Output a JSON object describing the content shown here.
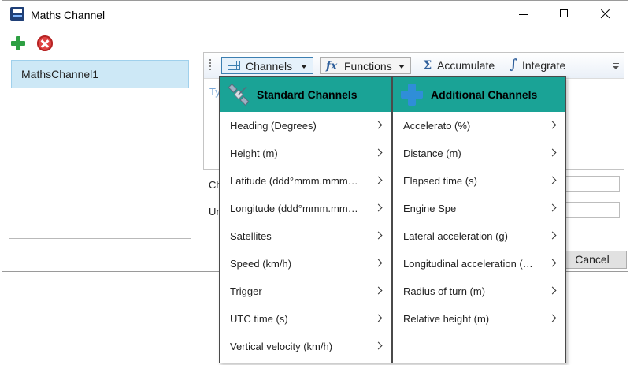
{
  "window": {
    "title": "Maths Channel"
  },
  "channel_list": {
    "items": [
      "MathsChannel1"
    ]
  },
  "toolbar": {
    "channels_label": "Channels",
    "functions_label": "Functions",
    "accumulate_label": "Accumulate",
    "integrate_label": "Integrate"
  },
  "editor": {
    "placeholder_fragment": "Ty"
  },
  "fields": {
    "label1_fragment": "Ch",
    "label2_fragment": "Un"
  },
  "buttons": {
    "cancel_label": "Cancel"
  },
  "menu": {
    "standard_header": "Standard Channels",
    "additional_header": "Additional Channels",
    "standard_items": [
      "Heading (Degrees)",
      "Height (m)",
      "Latitude (ddd°mmm.mmm…",
      "Longitude (ddd°mmm.mm…",
      "Satellites",
      "Speed (km/h)",
      "Trigger",
      "UTC time (s)",
      "Vertical velocity (km/h)"
    ],
    "additional_items": [
      "Accelerato (%)",
      "Distance (m)",
      "Elapsed time (s)",
      "Engine Spe",
      "Lateral acceleration (g)",
      "Longitudinal acceleration (…",
      "Radius of turn (m)",
      "Relative height (m)"
    ],
    "header_color": "#1aa396"
  },
  "icons": {
    "add": "plus-icon",
    "remove": "remove-icon",
    "channels": "grid-icon",
    "functions": "fx-icon",
    "accumulate": "sigma-icon",
    "integrate": "integral-icon"
  }
}
